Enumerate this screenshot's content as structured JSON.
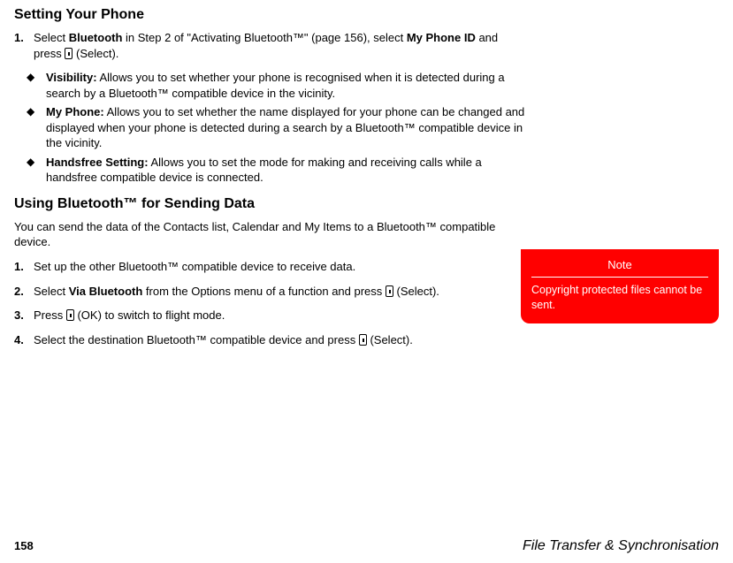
{
  "heading1": "Setting Your Phone",
  "step1": {
    "num": "1.",
    "pre": "Select ",
    "b1": "Bluetooth",
    "mid1": " in Step 2 of \"Activating Bluetooth™\" (page 156), select ",
    "b2": "My Phone ID",
    "mid2": " and press ",
    "after": " (Select)."
  },
  "bullets": [
    {
      "label": "Visibility:",
      "text": " Allows you to set whether your phone is recognised when it is detected during a search by a Bluetooth™ compatible device in the vicinity."
    },
    {
      "label": "My Phone:",
      "text": " Allows you to set whether the name displayed for your phone can be changed and displayed when your phone is detected during a search by a Bluetooth™ compatible device in the vicinity."
    },
    {
      "label": "Handsfree Setting:",
      "text": " Allows you to set the mode for making and receiving calls while a handsfree compatible device is connected."
    }
  ],
  "heading2": "Using Bluetooth™ for Sending Data",
  "intro2": "You can send the data of the Contacts list, Calendar and My Items to a Bluetooth™ compatible device.",
  "steps2": [
    {
      "num": "1.",
      "pre": "Set up the other Bluetooth™ compatible device to receive data.",
      "b": "",
      "mid": "",
      "icon": false,
      "after": ""
    },
    {
      "num": "2.",
      "pre": "Select ",
      "b": "Via Bluetooth",
      "mid": " from the Options menu of a function and press ",
      "icon": true,
      "after": " (Select)."
    },
    {
      "num": "3.",
      "pre": "Press ",
      "b": "",
      "mid": "",
      "icon": true,
      "after": " (OK) to switch to flight mode."
    },
    {
      "num": "4.",
      "pre": "Select the destination Bluetooth™ compatible device and press ",
      "b": "",
      "mid": "",
      "icon": true,
      "after": " (Select)."
    }
  ],
  "note": {
    "title": "Note",
    "body": "Copyright protected files cannot be sent."
  },
  "footer": {
    "page": "158",
    "section": "File Transfer & Synchronisation"
  },
  "diamond": "◆"
}
